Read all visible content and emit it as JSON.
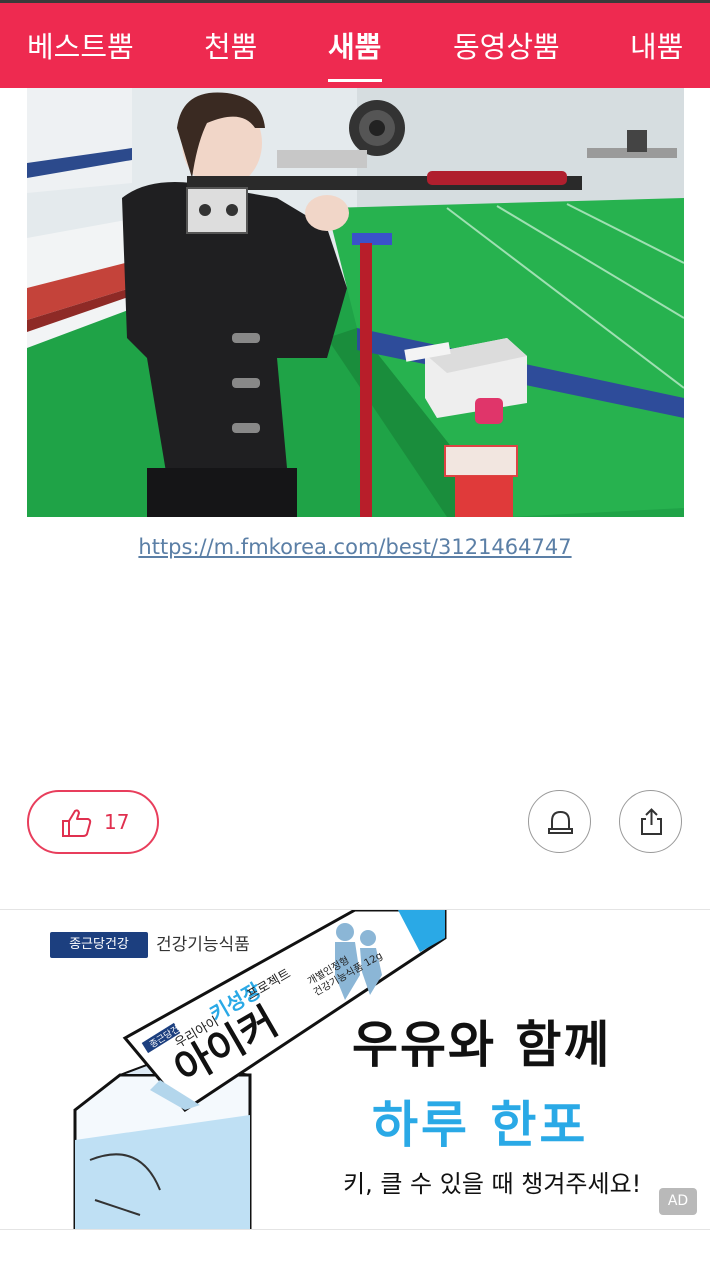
{
  "nav": {
    "tabs": [
      {
        "label": "베스트뿜",
        "active": false
      },
      {
        "label": "천뿜",
        "active": false
      },
      {
        "label": "새뿜",
        "active": true
      },
      {
        "label": "동영상뿜",
        "active": false
      },
      {
        "label": "내뿜",
        "active": false
      }
    ],
    "accent_color": "#ee2a50"
  },
  "post": {
    "image_icon": "photo-of-shooter-with-rifle",
    "source_link": "https://m.fmkorea.com/best/3121464747"
  },
  "actions": {
    "like_icon": "thumbs-up-icon",
    "like_count": "17",
    "alarm_icon": "siren-icon",
    "share_icon": "share-icon"
  },
  "ad": {
    "brand_logo": "종근당건강",
    "category": "건강기능식품",
    "pack_brand": "종근당건강",
    "pack_tagline_prefix": "우리아이",
    "pack_highlight": "키성장",
    "pack_tagline_suffix": "프로젝트",
    "pack_product": "아이커",
    "pack_note_1": "개별인정형",
    "pack_note_2": "건강기능식품 12g",
    "headline_1": "우유와 함께",
    "headline_2": "하루 한포",
    "tagline": "키, 클 수 있을 때 챙겨주세요!",
    "badge": "AD",
    "highlight_color": "#2aa9e6"
  }
}
